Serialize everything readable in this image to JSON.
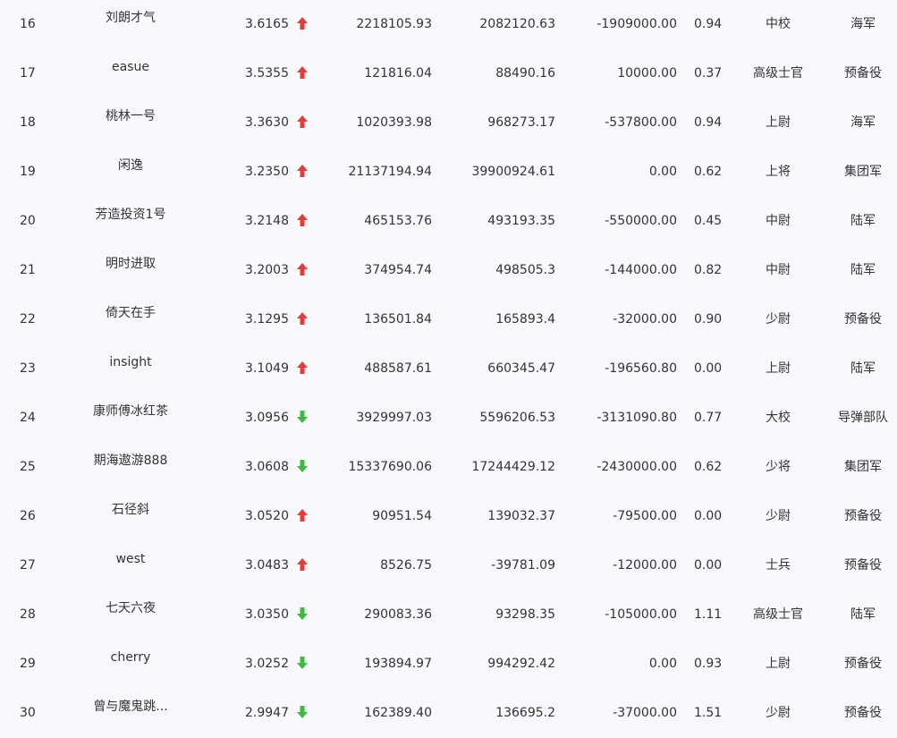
{
  "colors": {
    "up": "#e43b3b",
    "down": "#3fb93f"
  },
  "rows": [
    {
      "rank": "16",
      "name": "刘朗才气",
      "ratio": "3.6165",
      "trend": "up",
      "asset": "2218105.93",
      "market_value": "2082120.63",
      "flow": "-1909000.00",
      "position": "0.94",
      "military_rank": "中校",
      "army": "海军"
    },
    {
      "rank": "17",
      "name": "easue",
      "ratio": "3.5355",
      "trend": "up",
      "asset": "121816.04",
      "market_value": "88490.16",
      "flow": "10000.00",
      "position": "0.37",
      "military_rank": "高级士官",
      "army": "预备役"
    },
    {
      "rank": "18",
      "name": "桃林一号",
      "ratio": "3.3630",
      "trend": "up",
      "asset": "1020393.98",
      "market_value": "968273.17",
      "flow": "-537800.00",
      "position": "0.94",
      "military_rank": "上尉",
      "army": "海军"
    },
    {
      "rank": "19",
      "name": "闲逸",
      "ratio": "3.2350",
      "trend": "up",
      "asset": "21137194.94",
      "market_value": "39900924.61",
      "flow": "0.00",
      "position": "0.62",
      "military_rank": "上将",
      "army": "集团军"
    },
    {
      "rank": "20",
      "name": "芳造投资1号",
      "ratio": "3.2148",
      "trend": "up",
      "asset": "465153.76",
      "market_value": "493193.35",
      "flow": "-550000.00",
      "position": "0.45",
      "military_rank": "中尉",
      "army": "陆军"
    },
    {
      "rank": "21",
      "name": "明时进取",
      "ratio": "3.2003",
      "trend": "up",
      "asset": "374954.74",
      "market_value": "498505.3",
      "flow": "-144000.00",
      "position": "0.82",
      "military_rank": "中尉",
      "army": "陆军"
    },
    {
      "rank": "22",
      "name": "倚天在手",
      "ratio": "3.1295",
      "trend": "up",
      "asset": "136501.84",
      "market_value": "165893.4",
      "flow": "-32000.00",
      "position": "0.90",
      "military_rank": "少尉",
      "army": "预备役"
    },
    {
      "rank": "23",
      "name": "insight",
      "ratio": "3.1049",
      "trend": "up",
      "asset": "488587.61",
      "market_value": "660345.47",
      "flow": "-196560.80",
      "position": "0.00",
      "military_rank": "上尉",
      "army": "陆军"
    },
    {
      "rank": "24",
      "name": "康师傅冰红茶",
      "ratio": "3.0956",
      "trend": "down",
      "asset": "3929997.03",
      "market_value": "5596206.53",
      "flow": "-3131090.80",
      "position": "0.77",
      "military_rank": "大校",
      "army": "导弹部队"
    },
    {
      "rank": "25",
      "name": "期海遨游888",
      "ratio": "3.0608",
      "trend": "down",
      "asset": "15337690.06",
      "market_value": "17244429.12",
      "flow": "-2430000.00",
      "position": "0.62",
      "military_rank": "少将",
      "army": "集团军"
    },
    {
      "rank": "26",
      "name": "石径斜",
      "ratio": "3.0520",
      "trend": "up",
      "asset": "90951.54",
      "market_value": "139032.37",
      "flow": "-79500.00",
      "position": "0.00",
      "military_rank": "少尉",
      "army": "预备役"
    },
    {
      "rank": "27",
      "name": "west",
      "ratio": "3.0483",
      "trend": "up",
      "asset": "8526.75",
      "market_value": "-39781.09",
      "flow": "-12000.00",
      "position": "0.00",
      "military_rank": "士兵",
      "army": "预备役"
    },
    {
      "rank": "28",
      "name": "七天六夜",
      "ratio": "3.0350",
      "trend": "down",
      "asset": "290083.36",
      "market_value": "93298.35",
      "flow": "-105000.00",
      "position": "1.11",
      "military_rank": "高级士官",
      "army": "陆军"
    },
    {
      "rank": "29",
      "name": "cherry",
      "ratio": "3.0252",
      "trend": "down",
      "asset": "193894.97",
      "market_value": "994292.42",
      "flow": "0.00",
      "position": "0.93",
      "military_rank": "上尉",
      "army": "预备役"
    },
    {
      "rank": "30",
      "name": "曾与魔鬼跳...",
      "ratio": "2.9947",
      "trend": "down",
      "asset": "162389.40",
      "market_value": "136695.2",
      "flow": "-37000.00",
      "position": "1.51",
      "military_rank": "少尉",
      "army": "预备役"
    }
  ]
}
